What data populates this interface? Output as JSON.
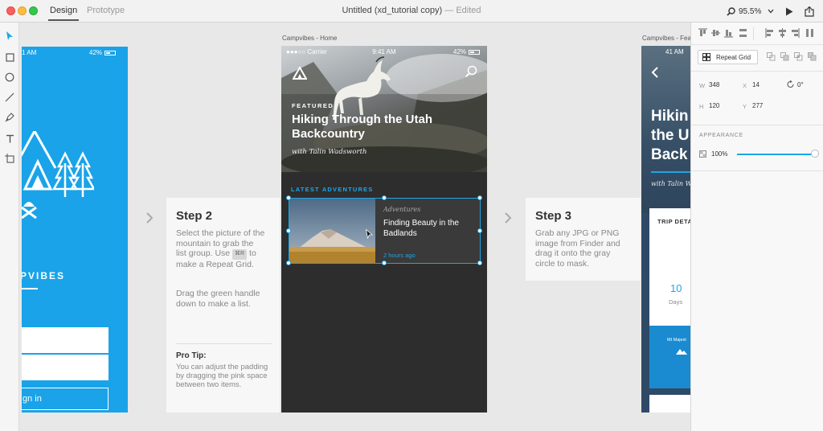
{
  "window": {
    "tabs": [
      "Design",
      "Prototype"
    ],
    "title": "Untitled (xd_tutorial copy)",
    "title_sep": " — ",
    "status": "Edited",
    "zoom": "95.5%"
  },
  "artboards": {
    "left": {
      "time": "1 AM",
      "battery": "42%",
      "brand": "PVIBES",
      "signin": "gn in"
    },
    "main": {
      "label": "Campvibes - Home",
      "carrier": "●●●○○ Carrier",
      "time": "9:41 AM",
      "battery": "42%",
      "kicker": "FEATURED",
      "title": "Hiking Through the Utah Backcountry",
      "byline": "with Talin Wadsworth",
      "section": "LATEST ADVENTURES",
      "card": {
        "category": "Adventures",
        "title": "Finding Beauty in the Badlands",
        "ago": "2 hours ago"
      }
    },
    "right": {
      "label": "Campvibes - Fea",
      "time": "41 AM",
      "title_lines": [
        "Hikin",
        "the U",
        "Back"
      ],
      "byline": "with Talin W",
      "trip": "TRIP DETA",
      "num": "10",
      "days": "Days",
      "tile_label": "Mt Majest"
    }
  },
  "steps": {
    "step2": {
      "title": "Step 2",
      "text_before_key": "Select the picture of the mountain to grab the list group. Use",
      "key": "⌘R",
      "text_after_key": "to make a Repeat Grid.",
      "text2": "Drag the green handle down to make a list.",
      "tip_title": "Pro Tip:",
      "tip": "You can adjust the padding by dragging the pink space between two items."
    },
    "step3": {
      "title": "Step 3",
      "text": "Grab any JPG or PNG image from Finder and drag it onto the gray circle to mask."
    }
  },
  "inspector": {
    "repeat_grid": "Repeat Grid",
    "w_label": "W",
    "w": "348",
    "x_label": "X",
    "x": "14",
    "h_label": "H",
    "h": "120",
    "y_label": "Y",
    "y": "277",
    "rotation": "0°",
    "appearance": "APPEARANCE",
    "opacity": "100%"
  },
  "colors": {
    "accent": "#1da6e8",
    "artboard_blue": "#1aa3e8",
    "dark_bg": "#2d2d2d"
  }
}
